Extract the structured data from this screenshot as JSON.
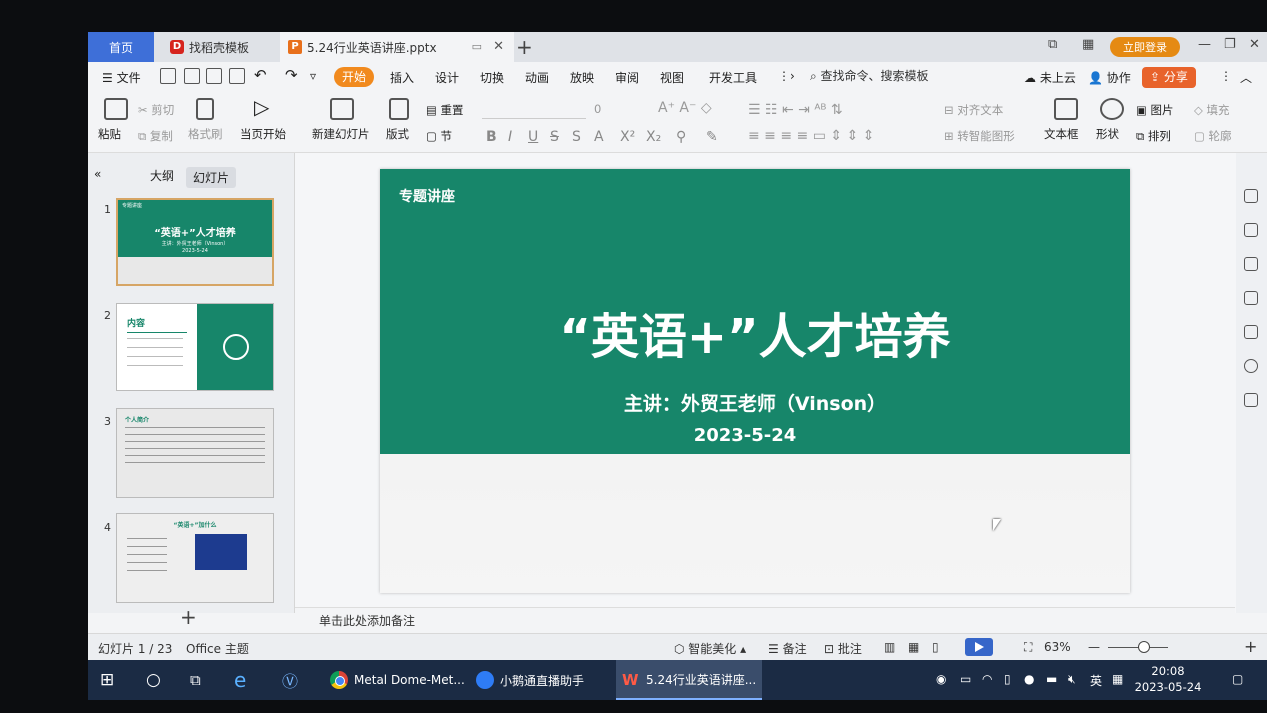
{
  "tabs": {
    "home": "首页",
    "template": "找稻壳模板",
    "document": "5.24行业英语讲座.pptx",
    "login": "立即登录"
  },
  "menu": {
    "file": "文件",
    "items": [
      "开始",
      "插入",
      "设计",
      "切换",
      "动画",
      "放映",
      "审阅",
      "视图",
      "开发工具"
    ],
    "search": "查找命令、搜索模板",
    "cloud": "未上云",
    "collab": "协作",
    "share": "分享"
  },
  "ribbon": {
    "paste": "粘贴",
    "cut": "剪切",
    "copy": "复制",
    "format_painter": "格式刷",
    "play_current": "当页开始",
    "new_slide": "新建幻灯片",
    "layout": "版式",
    "reset": "重置",
    "section": "节",
    "font_size": "0",
    "align_text": "对齐文本",
    "smart_graphic": "转智能图形",
    "text_box": "文本框",
    "shape": "形状",
    "picture": "图片",
    "arrange": "排列",
    "fill": "填充",
    "outline": "轮廓"
  },
  "left_panel": {
    "outline_tab": "大纲",
    "slides_tab": "幻灯片",
    "thumbnails": [
      {
        "num": "1",
        "tag": "专题讲座",
        "title": "“英语+”人才培养",
        "sub": "主讲：外贸王老师（Vinson）",
        "date": "2023-5-24"
      },
      {
        "num": "2",
        "title": "内容"
      },
      {
        "num": "3",
        "title": "个人简介"
      },
      {
        "num": "4",
        "title": "“英语+”加什么"
      }
    ]
  },
  "slide": {
    "tag": "专题讲座",
    "title": "“英语+”人才培养",
    "subtitle": "主讲：外贸王老师（Vinson）",
    "date": "2023-5-24"
  },
  "notes_placeholder": "单击此处添加备注",
  "status": {
    "slide_count": "幻灯片 1 / 23",
    "theme": "Office 主题",
    "beautify": "智能美化",
    "notes": "备注",
    "comments": "批注",
    "zoom": "63%"
  },
  "taskbar": {
    "apps": [
      "Metal Dome-Met...",
      "小鹅通直播助手",
      "5.24行业英语讲座..."
    ],
    "ime": "英",
    "time": "20:08",
    "date": "2023-05-24"
  }
}
